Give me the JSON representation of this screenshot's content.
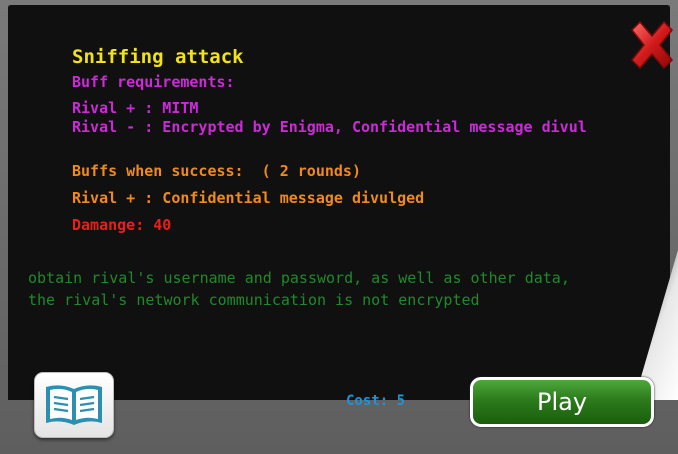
{
  "card": {
    "title": "Sniffing attack",
    "requirements_heading": "Buff requirements:",
    "requirements": [
      "Rival + : MITM",
      "Rival - : Encrypted by Enigma, Confidential message divul"
    ],
    "buffs_heading": "Buffs when success:  ( 2 rounds)",
    "buffs": [
      "Rival + : Confidential message divulged"
    ],
    "damage": "Damange: 40",
    "description": [
      "obtain rival's username and password, as well as other data,",
      "the rival's network communication is not encrypted"
    ],
    "cost": "Cost: 5"
  },
  "controls": {
    "play_label": "Play",
    "close_icon": "close-x-icon",
    "book_icon": "open-book-icon"
  },
  "colors": {
    "title": "#f2e21a",
    "requirements": "#cc2ad8",
    "buffs": "#f08a1c",
    "damage": "#e8201a",
    "description": "#1f8a2a",
    "cost": "#1f93d8",
    "play_button": "#2c7b1c"
  }
}
